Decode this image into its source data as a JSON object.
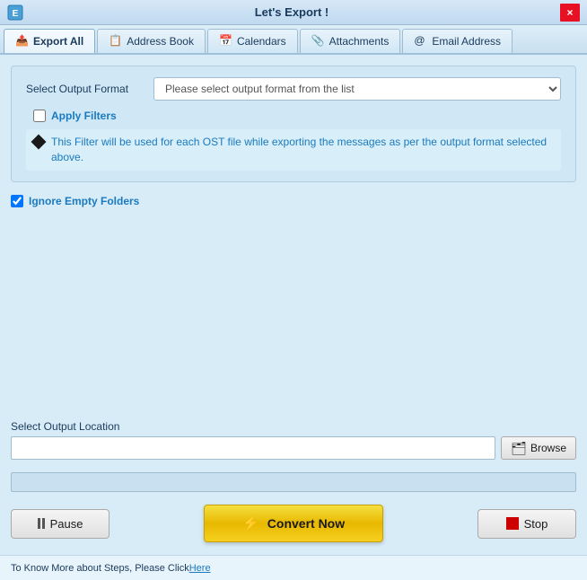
{
  "titlebar": {
    "title": "Let's Export !",
    "close_label": "×"
  },
  "tabs": [
    {
      "id": "export-all",
      "label": "Export All",
      "icon": "📤"
    },
    {
      "id": "address-book",
      "label": "Address Book",
      "icon": "📋"
    },
    {
      "id": "calendars",
      "label": "Calendars",
      "icon": "📅"
    },
    {
      "id": "attachments",
      "label": "Attachments",
      "icon": "📎"
    },
    {
      "id": "email-address",
      "label": "Email Address",
      "icon": "@"
    }
  ],
  "format_section": {
    "select_label": "Select Output Format",
    "select_placeholder": "Please select output format from the list",
    "filter_label": "Apply Filters",
    "filter_info": "This Filter will be used for each OST file while exporting the messages as per the output format selected above."
  },
  "ignore_section": {
    "label": "Ignore Empty Folders",
    "checked": true
  },
  "location_section": {
    "label": "Select Output Location",
    "input_placeholder": "",
    "browse_label": "Browse",
    "browse_icon": "🗂"
  },
  "buttons": {
    "pause": "Pause",
    "convert": "Convert Now",
    "stop": "Stop"
  },
  "footer": {
    "text": "To Know More about Steps, Please Click ",
    "link_text": "Here"
  }
}
